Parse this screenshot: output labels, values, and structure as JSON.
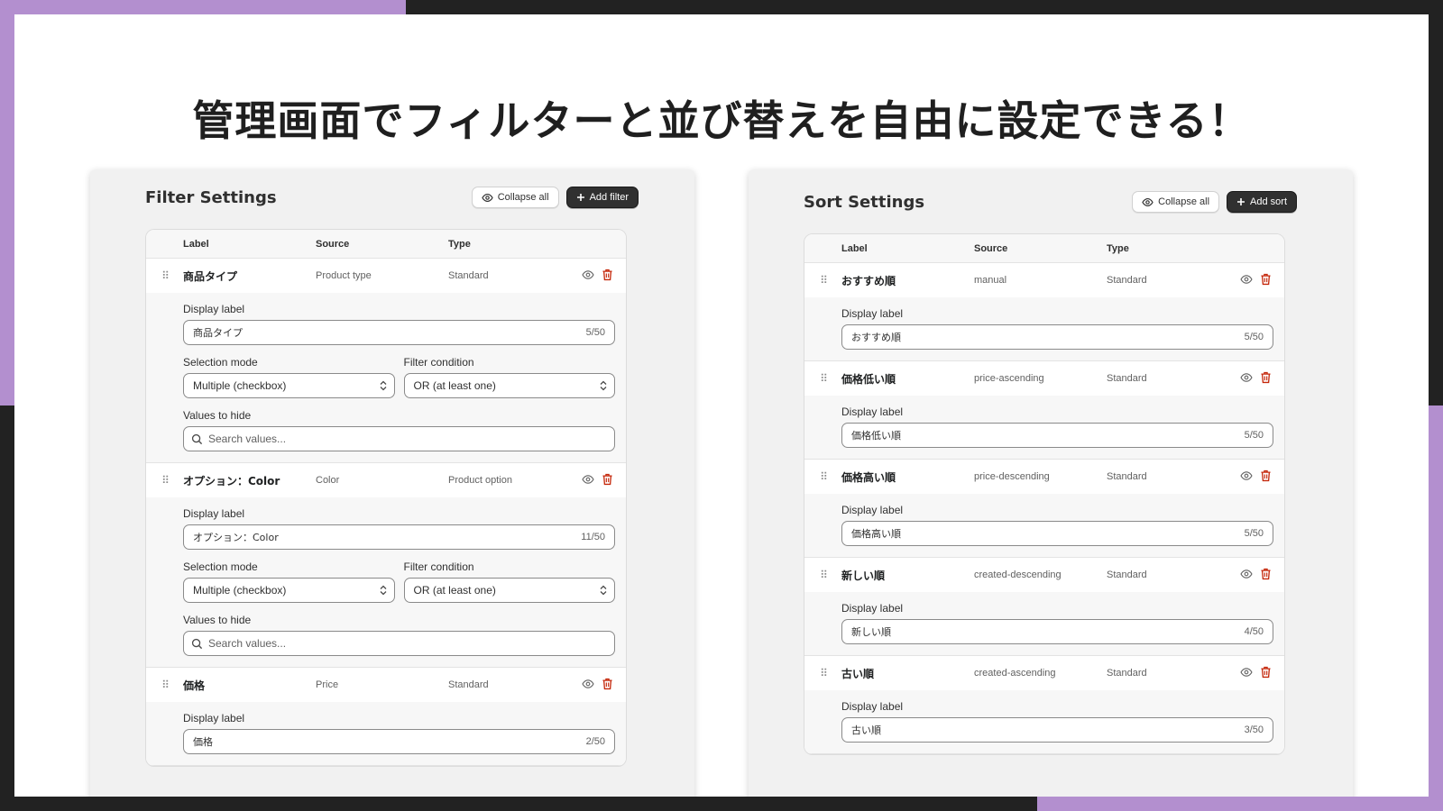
{
  "headline": "管理画面でフィルターと並び替えを自由に設定できる！",
  "colors": {
    "accent_purple": "#b38fcf",
    "dark": "#303030",
    "danger": "#c5280c"
  },
  "filter_settings": {
    "title": "Filter Settings",
    "collapse_label": "Collapse all",
    "add_label": "Add filter",
    "columns": {
      "label": "Label",
      "source": "Source",
      "type": "Type"
    },
    "field_labels": {
      "display_label": "Display label",
      "selection_mode": "Selection mode",
      "filter_condition": "Filter condition",
      "values_to_hide": "Values to hide",
      "search_placeholder": "Search values..."
    },
    "items": [
      {
        "label": "商品タイプ",
        "source": "Product type",
        "type": "Standard",
        "display_value": "商品タイプ",
        "counter": "5/50",
        "selection_mode": "Multiple (checkbox)",
        "filter_condition": "OR (at least one)"
      },
      {
        "label": "オプション：Color",
        "source": "Color",
        "type": "Product option",
        "display_value": "オプション：Color",
        "counter": "11/50",
        "selection_mode": "Multiple (checkbox)",
        "filter_condition": "OR (at least one)"
      },
      {
        "label": "価格",
        "source": "Price",
        "type": "Standard",
        "display_value": "価格",
        "counter": "2/50"
      }
    ]
  },
  "sort_settings": {
    "title": "Sort Settings",
    "collapse_label": "Collapse all",
    "add_label": "Add sort",
    "columns": {
      "label": "Label",
      "source": "Source",
      "type": "Type"
    },
    "field_labels": {
      "display_label": "Display label"
    },
    "items": [
      {
        "label": "おすすめ順",
        "source": "manual",
        "type": "Standard",
        "display_value": "おすすめ順",
        "counter": "5/50"
      },
      {
        "label": "価格低い順",
        "source": "price-ascending",
        "type": "Standard",
        "display_value": "価格低い順",
        "counter": "5/50"
      },
      {
        "label": "価格高い順",
        "source": "price-descending",
        "type": "Standard",
        "display_value": "価格高い順",
        "counter": "5/50"
      },
      {
        "label": "新しい順",
        "source": "created-descending",
        "type": "Standard",
        "display_value": "新しい順",
        "counter": "4/50"
      },
      {
        "label": "古い順",
        "source": "created-ascending",
        "type": "Standard",
        "display_value": "古い順",
        "counter": "3/50"
      }
    ]
  }
}
